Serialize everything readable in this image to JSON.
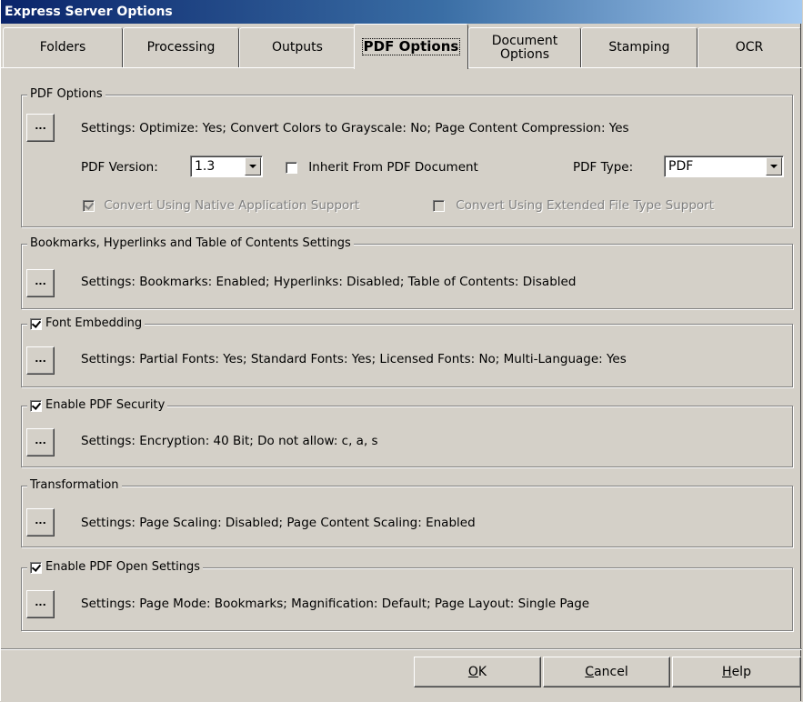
{
  "window": {
    "title": "Express Server Options"
  },
  "tabs": [
    {
      "label": "Folders"
    },
    {
      "label": "Processing"
    },
    {
      "label": "Outputs"
    },
    {
      "label": "PDF Options",
      "active": true
    },
    {
      "label": "Document Options"
    },
    {
      "label": "Stamping"
    },
    {
      "label": "OCR"
    }
  ],
  "pdf_options": {
    "title": "PDF Options",
    "button_label": "...",
    "settings": "Settings:  Optimize: Yes;  Convert Colors to Grayscale: No;  Page Content Compression: Yes",
    "version_label": "PDF Version:",
    "version_value": "1.3",
    "inherit_label": "Inherit From PDF Document",
    "inherit_checked": false,
    "type_label": "PDF Type:",
    "type_value": "PDF",
    "native_label": "Convert Using Native Application Support",
    "native_checked": true,
    "extended_label": "Convert Using Extended File Type Support",
    "extended_checked": false
  },
  "bookmarks": {
    "title": "Bookmarks, Hyperlinks and Table of Contents Settings",
    "button_label": "...",
    "settings": "Settings:  Bookmarks: Enabled;  Hyperlinks: Disabled;  Table of Contents: Disabled"
  },
  "font_embedding": {
    "title": "Font Embedding",
    "checked": true,
    "button_label": "...",
    "settings": "Settings:  Partial Fonts: Yes;  Standard Fonts: Yes;  Licensed Fonts: No;  Multi-Language: Yes"
  },
  "security": {
    "title": "Enable PDF Security",
    "checked": true,
    "button_label": "...",
    "settings": "Settings:  Encryption: 40 Bit;  Do not allow:  c, a, s"
  },
  "transformation": {
    "title": "Transformation",
    "button_label": "...",
    "settings": "Settings:  Page Scaling: Disabled;  Page Content Scaling: Enabled"
  },
  "open_settings": {
    "title": "Enable PDF Open Settings",
    "checked": true,
    "button_label": "...",
    "settings": "Settings:  Page Mode: Bookmarks;  Magnification: Default;  Page Layout: Single Page"
  },
  "buttons": {
    "ok_accel": "O",
    "ok_rest": "K",
    "cancel_accel": "C",
    "cancel_rest": "ancel",
    "help_accel": "H",
    "help_rest": "elp"
  }
}
